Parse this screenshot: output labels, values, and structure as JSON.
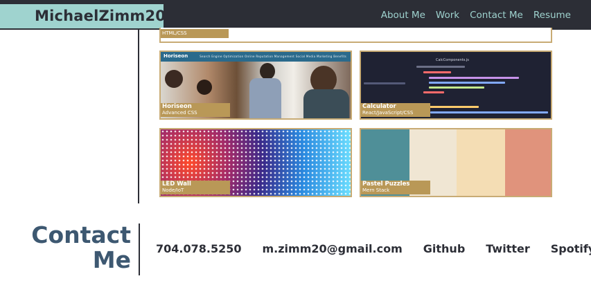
{
  "header": {
    "brand": "MichaelZimm20",
    "nav": [
      "About Me",
      "Work",
      "Contact Me",
      "Resume"
    ]
  },
  "work": {
    "top_card_label": "HTML/CSS",
    "projects": [
      {
        "title": "Horiseon",
        "subtitle": "Advanced CSS"
      },
      {
        "title": "Calculator",
        "subtitle": "React/JavaScript/CSS"
      },
      {
        "title": "LED Wall",
        "subtitle": "Node/IoT"
      },
      {
        "title": "Pastel Puzzles",
        "subtitle": "Mern Stack"
      }
    ],
    "horiseon_site": {
      "logo": "Horiseon",
      "links": "Search Engine Optimization     Online Reputation Management     Social Media Marketing     Benefits"
    },
    "calculator_code": [
      "CalcComponents.js"
    ]
  },
  "contact": {
    "title_line1": "Contact",
    "title_line2": "Me",
    "phone": "704.078.5250",
    "email": "m.zimm20@gmail.com",
    "github": "Github",
    "twitter": "Twitter",
    "spotify": "Spotify"
  },
  "colors": {
    "header_bg": "#2c2e36",
    "brand_bg": "#9fd3cf",
    "accent_gold": "#b99857",
    "contact_title": "#3d5871",
    "pastel": [
      "#4f8f98",
      "#f0e6d3",
      "#f4ddb4",
      "#e0937c"
    ]
  }
}
